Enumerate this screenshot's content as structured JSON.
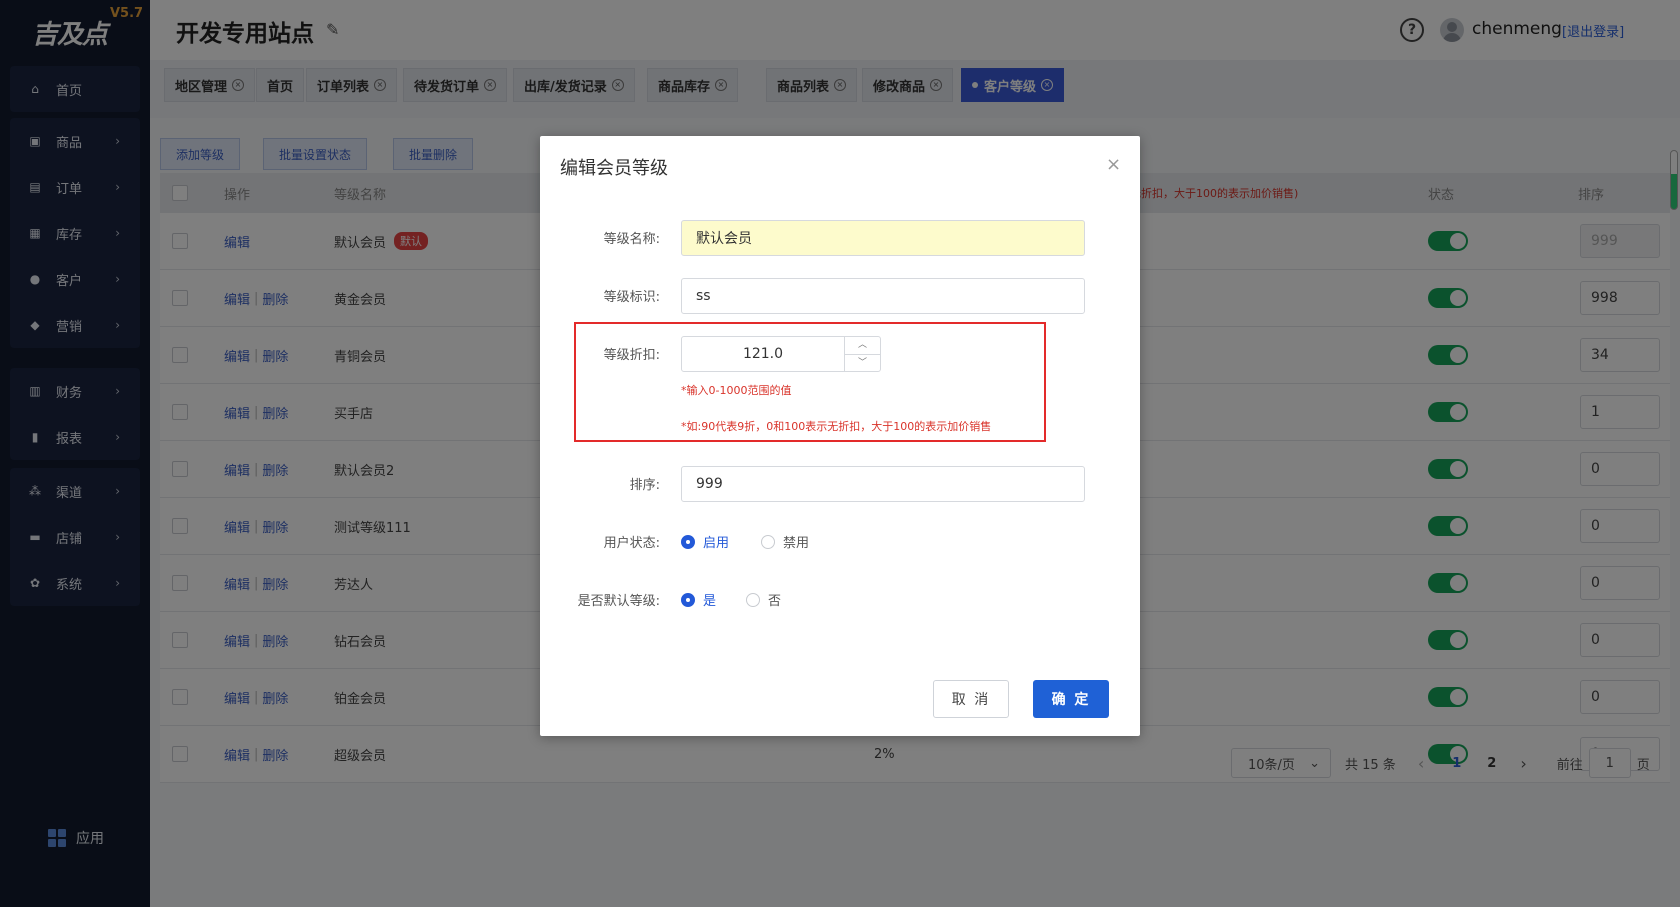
{
  "brand": {
    "logo_text": "吉及点",
    "version": "V5.7"
  },
  "sidebar": {
    "items": [
      {
        "label": "首页",
        "icon": "home-icon"
      },
      {
        "label": "商品",
        "icon": "cart-icon"
      },
      {
        "label": "订单",
        "icon": "order-icon"
      },
      {
        "label": "库存",
        "icon": "stock-icon"
      },
      {
        "label": "客户",
        "icon": "customer-icon"
      },
      {
        "label": "营销",
        "icon": "tag-icon"
      },
      {
        "label": "财务",
        "icon": "finance-icon"
      },
      {
        "label": "报表",
        "icon": "chart-icon"
      },
      {
        "label": "渠道",
        "icon": "channel-icon"
      },
      {
        "label": "店铺",
        "icon": "shop-icon"
      },
      {
        "label": "系统",
        "icon": "gear-icon"
      }
    ],
    "app_label": "应用"
  },
  "header": {
    "title": "开发专用站点",
    "help": "?",
    "username": "chenmeng",
    "logout": "[退出登录]"
  },
  "tabs": [
    {
      "label": "地区管理"
    },
    {
      "label": "首页"
    },
    {
      "label": "订单列表"
    },
    {
      "label": "待发货订单"
    },
    {
      "label": "出库/发货记录"
    },
    {
      "label": "商品库存"
    },
    {
      "label": "商品列表"
    },
    {
      "label": "修改商品"
    },
    {
      "label": "客户等级",
      "active": true
    }
  ],
  "toolbar": {
    "add": "添加等级",
    "batch_status": "批量设置状态",
    "batch_delete": "批量删除"
  },
  "table": {
    "headers": {
      "op": "操作",
      "name": "等级名称",
      "discount_hint": "无折扣，大于100的表示加价销售)",
      "status": "状态",
      "sort": "排序"
    },
    "edit_label": "编辑",
    "delete_label": "删除",
    "default_badge": "默认",
    "rows": [
      {
        "name": "默认会员",
        "default": true,
        "discount": "",
        "sort": "999"
      },
      {
        "name": "黄金会员",
        "discount": "",
        "sort": "998"
      },
      {
        "name": "青铜会员",
        "discount": "",
        "sort": "34"
      },
      {
        "name": "买手店",
        "discount": "",
        "sort": "1"
      },
      {
        "name": "默认会员2",
        "discount": "",
        "sort": "0"
      },
      {
        "name": "测试等级111",
        "discount": "",
        "sort": "0"
      },
      {
        "name": "芳达人",
        "discount": "",
        "sort": "0"
      },
      {
        "name": "钻石会员",
        "discount": "",
        "sort": "0"
      },
      {
        "name": "铂金会员",
        "discount": "",
        "sort": "0"
      },
      {
        "name": "超级会员",
        "discount": "2%",
        "sort": "0"
      }
    ]
  },
  "pager": {
    "size": "10条/页",
    "total": "共 15 条",
    "prev": "‹",
    "pages": [
      "1",
      "2"
    ],
    "next": "›",
    "goto_prefix": "前往",
    "goto_value": "1",
    "goto_suffix": "页"
  },
  "dialog": {
    "title": "编辑会员等级",
    "close": "×",
    "name_label": "等级名称:",
    "name_value": "默认会员",
    "code_label": "等级标识:",
    "code_value": "ss",
    "discount_label": "等级折扣:",
    "discount_value": "121.0",
    "hint1": "*输入0-1000范围的值",
    "hint2": "*如:90代表9折，0和100表示无折扣，大于100的表示加价销售",
    "sort_label": "排序:",
    "sort_value": "999",
    "status_label": "用户状态:",
    "status_on": "启用",
    "status_off": "禁用",
    "default_label": "是否默认等级:",
    "default_yes": "是",
    "default_no": "否",
    "cancel": "取 消",
    "ok": "确 定"
  }
}
